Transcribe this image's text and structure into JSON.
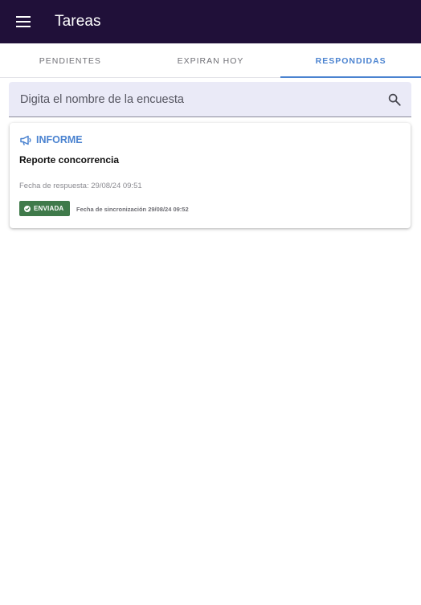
{
  "appbar": {
    "title": "Tareas",
    "menu_icon": "menu-icon",
    "background": "#201039"
  },
  "tabs": [
    {
      "label": "PENDIENTES",
      "active": false
    },
    {
      "label": "EXPIRAN HOY",
      "active": false
    },
    {
      "label": "RESPONDIDAS",
      "active": true
    }
  ],
  "search": {
    "placeholder": "Digita el nombre de la encuesta",
    "value": "",
    "icon": "search-icon"
  },
  "cards": [
    {
      "type_icon": "megaphone-icon",
      "type_label": "INFORME",
      "title": "Reporte concorrencia",
      "response_date": "Fecha de respuesta: 29/08/24 09:51",
      "status_icon": "check-circle-icon",
      "status_label": "ENVIADA",
      "status_color": "#3f7a4a",
      "sync_date": "Fecha de sincronización 29/08/24 09:52"
    }
  ],
  "colors": {
    "accent": "#4b83d0",
    "search_bg": "#eaeaf7"
  }
}
